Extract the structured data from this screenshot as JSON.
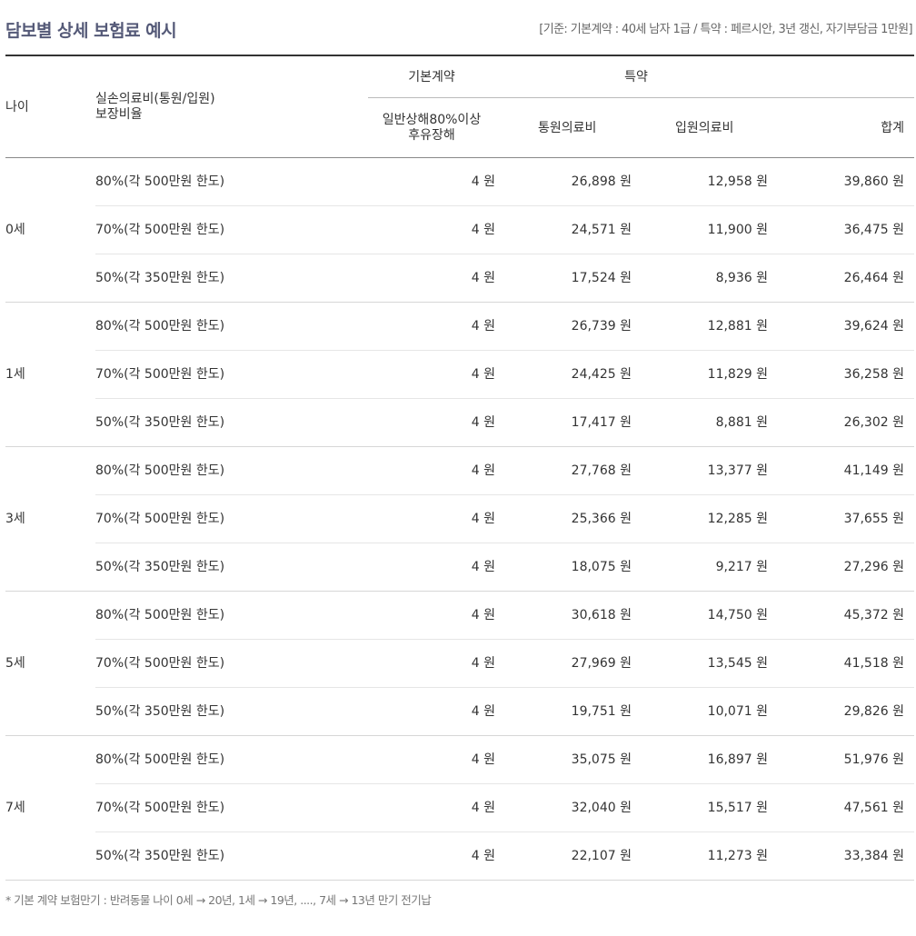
{
  "title": "담보별 상세 보험료 예시",
  "basis": "[기준: 기본계약 : 40세 남자 1급 / 특약 : 페르시안, 3년 갱신, 자기부담금 1만원]",
  "header": {
    "age": "나이",
    "ratio_line1": "실손의료비(통원/입원)",
    "ratio_line2": "보장비율",
    "basic_group": "기본계약",
    "rider_group": "특약",
    "injury_line1": "일반상해80%이상",
    "injury_line2": "후유장해",
    "outpatient": "통원의료비",
    "inpatient": "입원의료비",
    "total": "합계"
  },
  "groups": [
    {
      "age": "0세",
      "rows": [
        {
          "ratio": "80%(각 500만원 한도)",
          "injury": "4 원",
          "outpatient": "26,898 원",
          "inpatient": "12,958 원",
          "total": "39,860 원"
        },
        {
          "ratio": "70%(각 500만원 한도)",
          "injury": "4 원",
          "outpatient": "24,571 원",
          "inpatient": "11,900 원",
          "total": "36,475 원"
        },
        {
          "ratio": "50%(각 350만원 한도)",
          "injury": "4 원",
          "outpatient": "17,524 원",
          "inpatient": "8,936 원",
          "total": "26,464 원"
        }
      ]
    },
    {
      "age": "1세",
      "rows": [
        {
          "ratio": "80%(각 500만원 한도)",
          "injury": "4 원",
          "outpatient": "26,739 원",
          "inpatient": "12,881 원",
          "total": "39,624 원"
        },
        {
          "ratio": "70%(각 500만원 한도)",
          "injury": "4 원",
          "outpatient": "24,425 원",
          "inpatient": "11,829 원",
          "total": "36,258 원"
        },
        {
          "ratio": "50%(각 350만원 한도)",
          "injury": "4 원",
          "outpatient": "17,417 원",
          "inpatient": "8,881 원",
          "total": "26,302 원"
        }
      ]
    },
    {
      "age": "3세",
      "rows": [
        {
          "ratio": "80%(각 500만원 한도)",
          "injury": "4 원",
          "outpatient": "27,768 원",
          "inpatient": "13,377 원",
          "total": "41,149 원"
        },
        {
          "ratio": "70%(각 500만원 한도)",
          "injury": "4 원",
          "outpatient": "25,366 원",
          "inpatient": "12,285 원",
          "total": "37,655 원"
        },
        {
          "ratio": "50%(각 350만원 한도)",
          "injury": "4 원",
          "outpatient": "18,075 원",
          "inpatient": "9,217 원",
          "total": "27,296 원"
        }
      ]
    },
    {
      "age": "5세",
      "rows": [
        {
          "ratio": "80%(각 500만원 한도)",
          "injury": "4 원",
          "outpatient": "30,618 원",
          "inpatient": "14,750 원",
          "total": "45,372 원"
        },
        {
          "ratio": "70%(각 500만원 한도)",
          "injury": "4 원",
          "outpatient": "27,969 원",
          "inpatient": "13,545 원",
          "total": "41,518 원"
        },
        {
          "ratio": "50%(각 350만원 한도)",
          "injury": "4 원",
          "outpatient": "19,751 원",
          "inpatient": "10,071 원",
          "total": "29,826 원"
        }
      ]
    },
    {
      "age": "7세",
      "rows": [
        {
          "ratio": "80%(각 500만원 한도)",
          "injury": "4 원",
          "outpatient": "35,075 원",
          "inpatient": "16,897 원",
          "total": "51,976 원"
        },
        {
          "ratio": "70%(각 500만원 한도)",
          "injury": "4 원",
          "outpatient": "32,040 원",
          "inpatient": "15,517 원",
          "total": "47,561 원"
        },
        {
          "ratio": "50%(각 350만원 한도)",
          "injury": "4 원",
          "outpatient": "22,107 원",
          "inpatient": "11,273 원",
          "total": "33,384 원"
        }
      ]
    }
  ],
  "footnote": "* 기본 계약 보험만기 : 반려동물 나이 0세 → 20년, 1세 → 19년, ...., 7세 → 13년 만기 전기납"
}
